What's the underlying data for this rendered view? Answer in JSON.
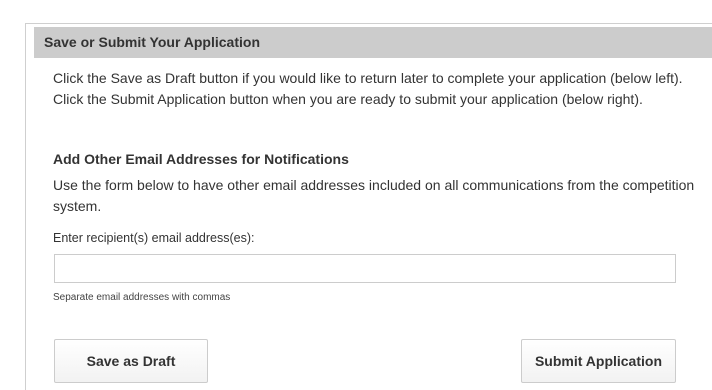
{
  "section": {
    "header": "Save or Submit Your Application",
    "intro": "Click the Save as Draft button if you would like to return later to complete your application (below left). Click the Submit Application button when you are ready to submit your application (below right)."
  },
  "notifications": {
    "heading": "Add Other Email Addresses for Notifications",
    "description": "Use the form below to have other email addresses included on all communications from the competition system.",
    "email_label": "Enter recipient(s) email address(es):",
    "email_value": "",
    "email_help": "Separate email addresses with commas"
  },
  "actions": {
    "save_draft_label": "Save as Draft",
    "submit_label": "Submit Application"
  }
}
